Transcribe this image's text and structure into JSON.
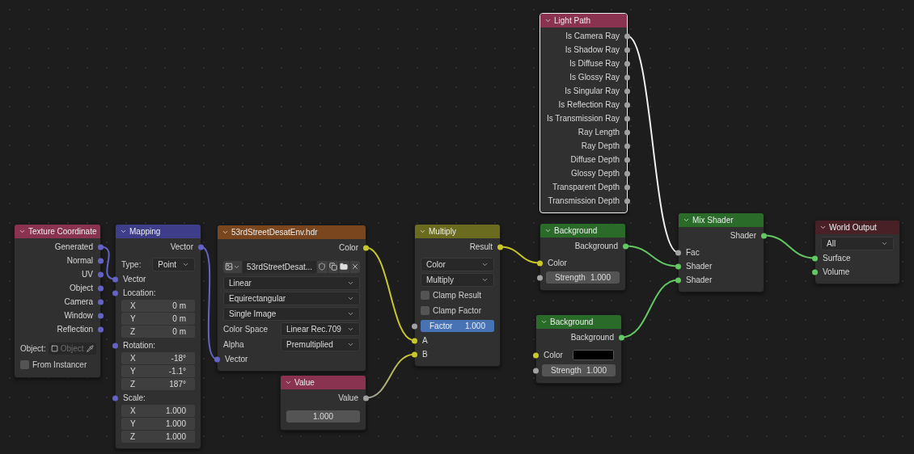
{
  "nodes": [
    {
      "title": "Texture Coordinate",
      "color": "#8a3350",
      "selected": false,
      "rows": [
        {
          "kind": "output",
          "label": "Generated",
          "color": "#6363c7"
        },
        {
          "kind": "output",
          "label": "Normal",
          "color": "#6363c7"
        },
        {
          "kind": "output",
          "label": "UV",
          "color": "#6363c7"
        },
        {
          "kind": "output",
          "label": "Object",
          "color": "#6363c7"
        },
        {
          "kind": "output",
          "label": "Camera",
          "color": "#6363c7"
        },
        {
          "kind": "output",
          "label": "Window",
          "color": "#6363c7"
        },
        {
          "kind": "output",
          "label": "Reflection",
          "color": "#6363c7"
        },
        {
          "kind": "object-picker",
          "label": "Object:",
          "placeholder": "Object"
        },
        {
          "kind": "checkbox",
          "label": "From Instancer",
          "checked": false
        }
      ]
    },
    {
      "title": "Mapping",
      "color": "#3d3d8a",
      "selected": false,
      "rows": [
        {
          "kind": "output",
          "label": "Vector",
          "color": "#6363c7"
        },
        {
          "kind": "labeled-dropdown",
          "label": "Type:",
          "value": "Point"
        },
        {
          "kind": "input",
          "label": "Vector",
          "color": "#6363c7"
        },
        {
          "kind": "heading",
          "label": "Location:",
          "color": "#6363c7"
        },
        {
          "kind": "axis",
          "label": "X",
          "value": "0 m"
        },
        {
          "kind": "axis",
          "label": "Y",
          "value": "0 m"
        },
        {
          "kind": "axis",
          "label": "Z",
          "value": "0 m"
        },
        {
          "kind": "heading",
          "label": "Rotation:",
          "color": "#6363c7"
        },
        {
          "kind": "axis",
          "label": "X",
          "value": "-18°"
        },
        {
          "kind": "axis",
          "label": "Y",
          "value": "-1.1°"
        },
        {
          "kind": "axis",
          "label": "Z",
          "value": "187°"
        },
        {
          "kind": "heading",
          "label": "Scale:",
          "color": "#6363c7"
        },
        {
          "kind": "axis",
          "label": "X",
          "value": "1.000"
        },
        {
          "kind": "axis",
          "label": "Y",
          "value": "1.000"
        },
        {
          "kind": "axis",
          "label": "Z",
          "value": "1.000"
        }
      ]
    },
    {
      "title": "53rdStreetDesatEnv.hdr",
      "color": "#7a461d",
      "selected": false,
      "rows": [
        {
          "kind": "output",
          "label": "Color",
          "color": "#c7c729"
        },
        {
          "kind": "image-picker",
          "value": "53rdStreetDesat..."
        },
        {
          "kind": "dropdown",
          "value": "Linear"
        },
        {
          "kind": "dropdown",
          "value": "Equirectangular"
        },
        {
          "kind": "dropdown",
          "value": "Single Image"
        },
        {
          "kind": "labeled-dropdown",
          "label": "Color Space",
          "value": "Linear Rec.709"
        },
        {
          "kind": "labeled-dropdown",
          "label": "Alpha",
          "value": "Premultiplied"
        },
        {
          "kind": "input",
          "label": "Vector",
          "color": "#6363c7"
        }
      ]
    },
    {
      "title": "Value",
      "color": "#8a3350",
      "selected": false,
      "rows": [
        {
          "kind": "output",
          "label": "Value",
          "color": "#a1a1a1"
        },
        {
          "kind": "number",
          "value": "1.000"
        }
      ]
    },
    {
      "title": "Multiply",
      "color": "#6b6b1f",
      "selected": false,
      "rows": [
        {
          "kind": "output",
          "label": "Result",
          "color": "#c7c729"
        },
        {
          "kind": "dropdown",
          "value": "Color"
        },
        {
          "kind": "dropdown",
          "value": "Multiply"
        },
        {
          "kind": "checkbox",
          "label": "Clamp Result",
          "checked": false
        },
        {
          "kind": "checkbox",
          "label": "Clamp Factor",
          "checked": false
        },
        {
          "kind": "slider",
          "label": "Factor",
          "value": "1.000",
          "level": 1,
          "color": "#a1a1a1"
        },
        {
          "kind": "input",
          "label": "A",
          "color": "#c7c729"
        },
        {
          "kind": "input",
          "label": "B",
          "color": "#c7c729"
        }
      ]
    },
    {
      "title": "Light Path",
      "color": "#8a3350",
      "selected": true,
      "rows": [
        {
          "kind": "output",
          "label": "Is Camera Ray",
          "color": "#a1a1a1"
        },
        {
          "kind": "output",
          "label": "Is Shadow Ray",
          "color": "#a1a1a1"
        },
        {
          "kind": "output",
          "label": "Is Diffuse Ray",
          "color": "#a1a1a1"
        },
        {
          "kind": "output",
          "label": "Is Glossy Ray",
          "color": "#a1a1a1"
        },
        {
          "kind": "output",
          "label": "Is Singular Ray",
          "color": "#a1a1a1"
        },
        {
          "kind": "output",
          "label": "Is Reflection Ray",
          "color": "#a1a1a1"
        },
        {
          "kind": "output",
          "label": "Is Transmission Ray",
          "color": "#a1a1a1"
        },
        {
          "kind": "output",
          "label": "Ray Length",
          "color": "#a1a1a1"
        },
        {
          "kind": "output",
          "label": "Ray Depth",
          "color": "#a1a1a1"
        },
        {
          "kind": "output",
          "label": "Diffuse Depth",
          "color": "#a1a1a1"
        },
        {
          "kind": "output",
          "label": "Glossy Depth",
          "color": "#a1a1a1"
        },
        {
          "kind": "output",
          "label": "Transparent Depth",
          "color": "#a1a1a1"
        },
        {
          "kind": "output",
          "label": "Transmission Depth",
          "color": "#a1a1a1"
        }
      ]
    },
    {
      "title": "Background",
      "color": "#2a6b2a",
      "selected": false,
      "rows": [
        {
          "kind": "output",
          "label": "Background",
          "color": "#63c763"
        },
        {
          "kind": "input",
          "label": "Color",
          "color": "#c7c729"
        },
        {
          "kind": "number-field",
          "label": "Strength",
          "value": "1.000",
          "color": "#a1a1a1"
        }
      ]
    },
    {
      "title": "Background",
      "color": "#2a6b2a",
      "selected": false,
      "rows": [
        {
          "kind": "output",
          "label": "Background",
          "color": "#63c763"
        },
        {
          "kind": "color-input",
          "label": "Color",
          "color": "#c7c729",
          "swatch": {
            "color": "#000000"
          }
        },
        {
          "kind": "number-field",
          "label": "Strength",
          "value": "1.000",
          "color": "#a1a1a1"
        }
      ]
    },
    {
      "title": "Mix Shader",
      "color": "#2a6b2a",
      "selected": false,
      "rows": [
        {
          "kind": "output",
          "label": "Shader",
          "color": "#63c763"
        },
        {
          "kind": "input",
          "label": "Fac",
          "color": "#a1a1a1"
        },
        {
          "kind": "input",
          "label": "Shader",
          "color": "#63c763"
        },
        {
          "kind": "input",
          "label": "Shader",
          "color": "#63c763"
        }
      ]
    },
    {
      "title": "World Output",
      "color": "#4a2027",
      "selected": false,
      "rows": [
        {
          "kind": "dropdown",
          "value": "All"
        },
        {
          "kind": "input",
          "label": "Surface",
          "color": "#63c763"
        },
        {
          "kind": "input",
          "label": "Volume",
          "color": "#63c763"
        }
      ]
    }
  ]
}
